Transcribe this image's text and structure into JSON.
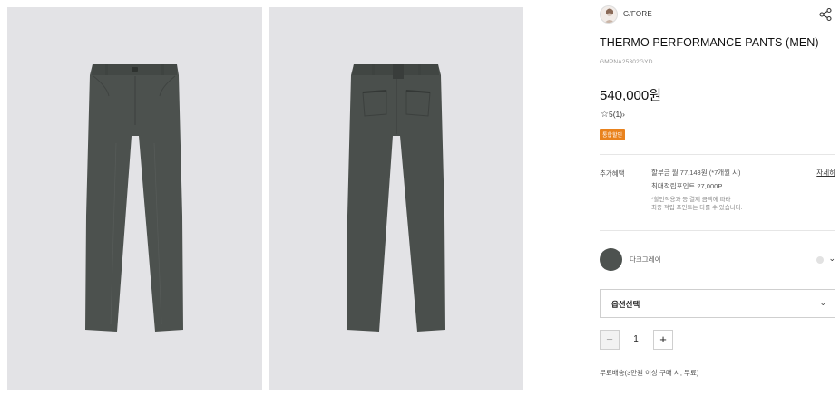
{
  "brand": {
    "name": "G/FORE",
    "logo_icon": "brand-avatar-icon"
  },
  "product": {
    "title": "THERMO PERFORMANCE PANTS (MEN)",
    "code": "GMPNA25302GYD",
    "price": "540,000원",
    "rating_value": "5",
    "rating_count": "(1)",
    "badge": "통합할인",
    "color_hex": "#4d524f"
  },
  "benefits": {
    "label": "추가혜택",
    "installment": "할부금 월 77,143원 (*7개월 시)",
    "points": "최대적립포인트 27,000P",
    "note_line1": "*할인적용과 등 결제 금액에 따라",
    "note_line2": "최종 적립 포인트는 다를 수 있습니다.",
    "detail_link": "자세히"
  },
  "color_option": {
    "name": "다크그레이"
  },
  "option_select": {
    "label": "옵션선택"
  },
  "quantity": {
    "value": "1",
    "minus": "−",
    "plus": "+"
  },
  "shipping": {
    "text": "무료배송(3만원 이상 구매 시, 무료)"
  },
  "icons": {
    "share": "share-icon",
    "star": "star-outline-icon",
    "chevron": "chevron-down-icon"
  }
}
